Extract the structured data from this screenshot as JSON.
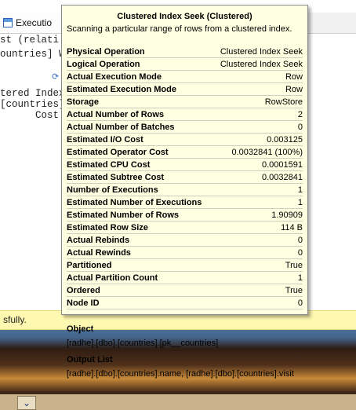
{
  "background": {
    "tab_label": "Executio",
    "code_lines": [
      "st (relati",
      "ountries] W",
      "tered Index",
      "[countries].[",
      "      Cost:"
    ],
    "status_text": "sfully.",
    "taskbar_button_glyph": "⌄"
  },
  "tooltip": {
    "title": "Clustered Index Seek (Clustered)",
    "description": "Scanning a particular range of rows from a clustered index.",
    "properties": [
      {
        "label": "Physical Operation",
        "value": "Clustered Index Seek"
      },
      {
        "label": "Logical Operation",
        "value": "Clustered Index Seek"
      },
      {
        "label": "Actual Execution Mode",
        "value": "Row"
      },
      {
        "label": "Estimated Execution Mode",
        "value": "Row"
      },
      {
        "label": "Storage",
        "value": "RowStore"
      },
      {
        "label": "Actual Number of Rows",
        "value": "2"
      },
      {
        "label": "Actual Number of Batches",
        "value": "0"
      },
      {
        "label": "Estimated I/O Cost",
        "value": "0.003125"
      },
      {
        "label": "Estimated Operator Cost",
        "value": "0.0032841 (100%)"
      },
      {
        "label": "Estimated CPU Cost",
        "value": "0.0001591"
      },
      {
        "label": "Estimated Subtree Cost",
        "value": "0.0032841"
      },
      {
        "label": "Number of Executions",
        "value": "1"
      },
      {
        "label": "Estimated Number of Executions",
        "value": "1"
      },
      {
        "label": "Estimated Number of Rows",
        "value": "1.90909"
      },
      {
        "label": "Estimated Row Size",
        "value": "114 B"
      },
      {
        "label": "Actual Rebinds",
        "value": "0"
      },
      {
        "label": "Actual Rewinds",
        "value": "0"
      },
      {
        "label": "Partitioned",
        "value": "True"
      },
      {
        "label": "Actual Partition Count",
        "value": "1"
      },
      {
        "label": "Ordered",
        "value": "True"
      },
      {
        "label": "Node ID",
        "value": "0"
      }
    ],
    "object_title": "Object",
    "object_value": "[radhe].[dbo].[countries].[pk__countries]",
    "output_title": "Output List",
    "output_value": "[radhe].[dbo].[countries].name, [radhe].[dbo].[countries].visit"
  },
  "colors": {
    "tooltip_background": "#ffffe1",
    "status_bar": "#fff8b0"
  }
}
